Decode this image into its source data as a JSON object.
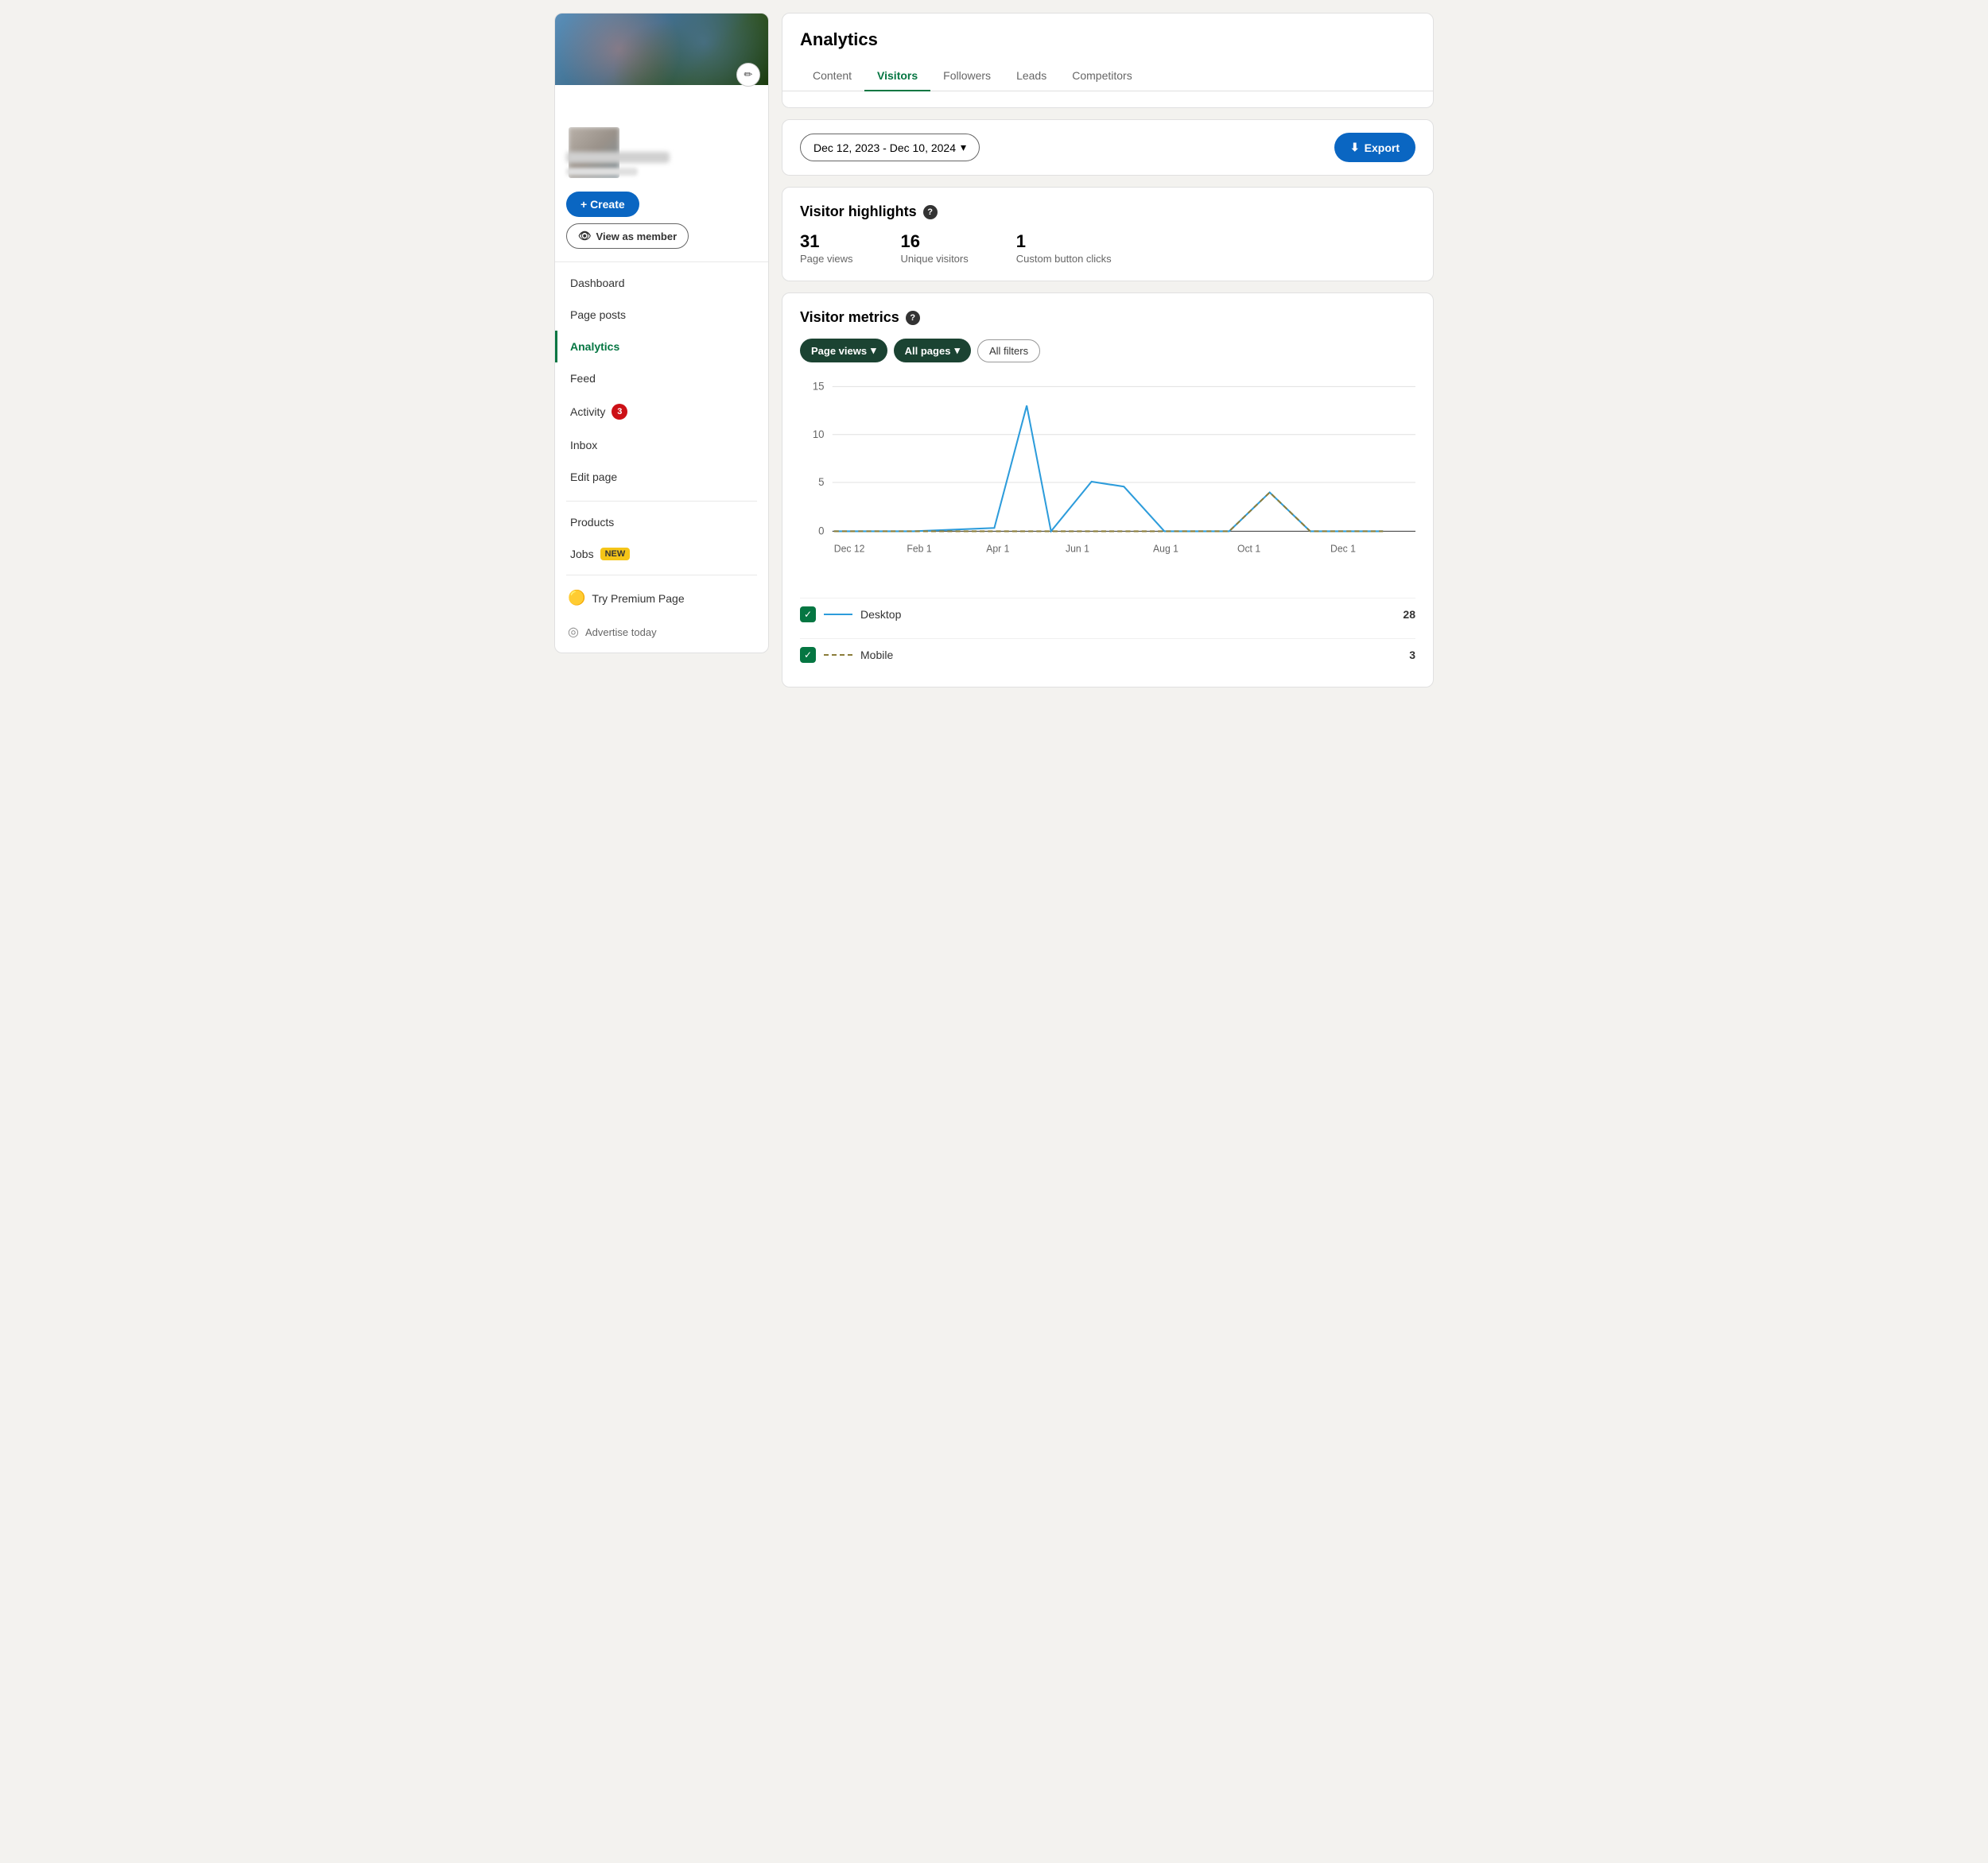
{
  "sidebar": {
    "create_label": "+ Create",
    "view_member_label": "View as member",
    "nav_items": [
      {
        "id": "dashboard",
        "label": "Dashboard",
        "active": false,
        "badge": null
      },
      {
        "id": "page-posts",
        "label": "Page posts",
        "active": false,
        "badge": null
      },
      {
        "id": "analytics",
        "label": "Analytics",
        "active": true,
        "badge": null
      },
      {
        "id": "feed",
        "label": "Feed",
        "active": false,
        "badge": null
      },
      {
        "id": "activity",
        "label": "Activity",
        "active": false,
        "badge": "3"
      },
      {
        "id": "inbox",
        "label": "Inbox",
        "active": false,
        "badge": null
      },
      {
        "id": "edit-page",
        "label": "Edit page",
        "active": false,
        "badge": null
      }
    ],
    "section2_items": [
      {
        "id": "products",
        "label": "Products",
        "badge": null
      },
      {
        "id": "jobs",
        "label": "Jobs",
        "badge": "NEW"
      }
    ],
    "premium_label": "Try Premium Page",
    "advertise_label": "Advertise today"
  },
  "analytics": {
    "title": "Analytics",
    "tabs": [
      {
        "id": "content",
        "label": "Content",
        "active": false
      },
      {
        "id": "visitors",
        "label": "Visitors",
        "active": true
      },
      {
        "id": "followers",
        "label": "Followers",
        "active": false
      },
      {
        "id": "leads",
        "label": "Leads",
        "active": false
      },
      {
        "id": "competitors",
        "label": "Competitors",
        "active": false
      }
    ]
  },
  "date_filter": {
    "label": "Dec 12, 2023 - Dec 10, 2024",
    "export_label": "Export"
  },
  "highlights": {
    "title": "Visitor highlights",
    "stats": [
      {
        "num": "31",
        "label": "Page views"
      },
      {
        "num": "16",
        "label": "Unique visitors"
      },
      {
        "num": "1",
        "label": "Custom button clicks"
      }
    ]
  },
  "metrics": {
    "title": "Visitor metrics",
    "filters": [
      {
        "id": "page-views",
        "label": "Page views",
        "type": "dark-dropdown"
      },
      {
        "id": "all-pages",
        "label": "All pages",
        "type": "dark-dropdown"
      },
      {
        "id": "all-filters",
        "label": "All filters",
        "type": "outline"
      }
    ],
    "chart": {
      "y_labels": [
        "15",
        "10",
        "5",
        "0"
      ],
      "x_labels": [
        "Dec 12",
        "Feb 1",
        "Apr 1",
        "Jun 1",
        "Aug 1",
        "Oct 1",
        "Dec 1"
      ],
      "desktop_points": [
        {
          "x": 0.0,
          "y": 0.0
        },
        {
          "x": 0.13,
          "y": 0.0
        },
        {
          "x": 0.27,
          "y": 0.03
        },
        {
          "x": 0.38,
          "y": 0.87
        },
        {
          "x": 0.44,
          "y": 0.0
        },
        {
          "x": 0.5,
          "y": 0.33
        },
        {
          "x": 0.57,
          "y": 0.27
        },
        {
          "x": 0.67,
          "y": 0.0
        },
        {
          "x": 0.78,
          "y": 0.0
        },
        {
          "x": 0.87,
          "y": 0.27
        },
        {
          "x": 0.93,
          "y": 0.0
        },
        {
          "x": 1.0,
          "y": 0.0
        }
      ],
      "mobile_points": [
        {
          "x": 0.0,
          "y": 0.0
        },
        {
          "x": 0.5,
          "y": 0.0
        },
        {
          "x": 0.78,
          "y": 0.0
        },
        {
          "x": 0.87,
          "y": 0.27
        },
        {
          "x": 0.93,
          "y": 0.0
        },
        {
          "x": 1.0,
          "y": 0.0
        }
      ]
    },
    "legend": [
      {
        "id": "desktop",
        "label": "Desktop",
        "type": "solid",
        "count": "28"
      },
      {
        "id": "mobile",
        "label": "Mobile",
        "type": "dashed",
        "count": "3"
      }
    ]
  },
  "icons": {
    "edit": "✏️",
    "eye": "👁",
    "download": "⬇",
    "chevron_down": "▾",
    "checkmark": "✓",
    "question": "?",
    "premium": "🟡",
    "advertise": "◎"
  }
}
